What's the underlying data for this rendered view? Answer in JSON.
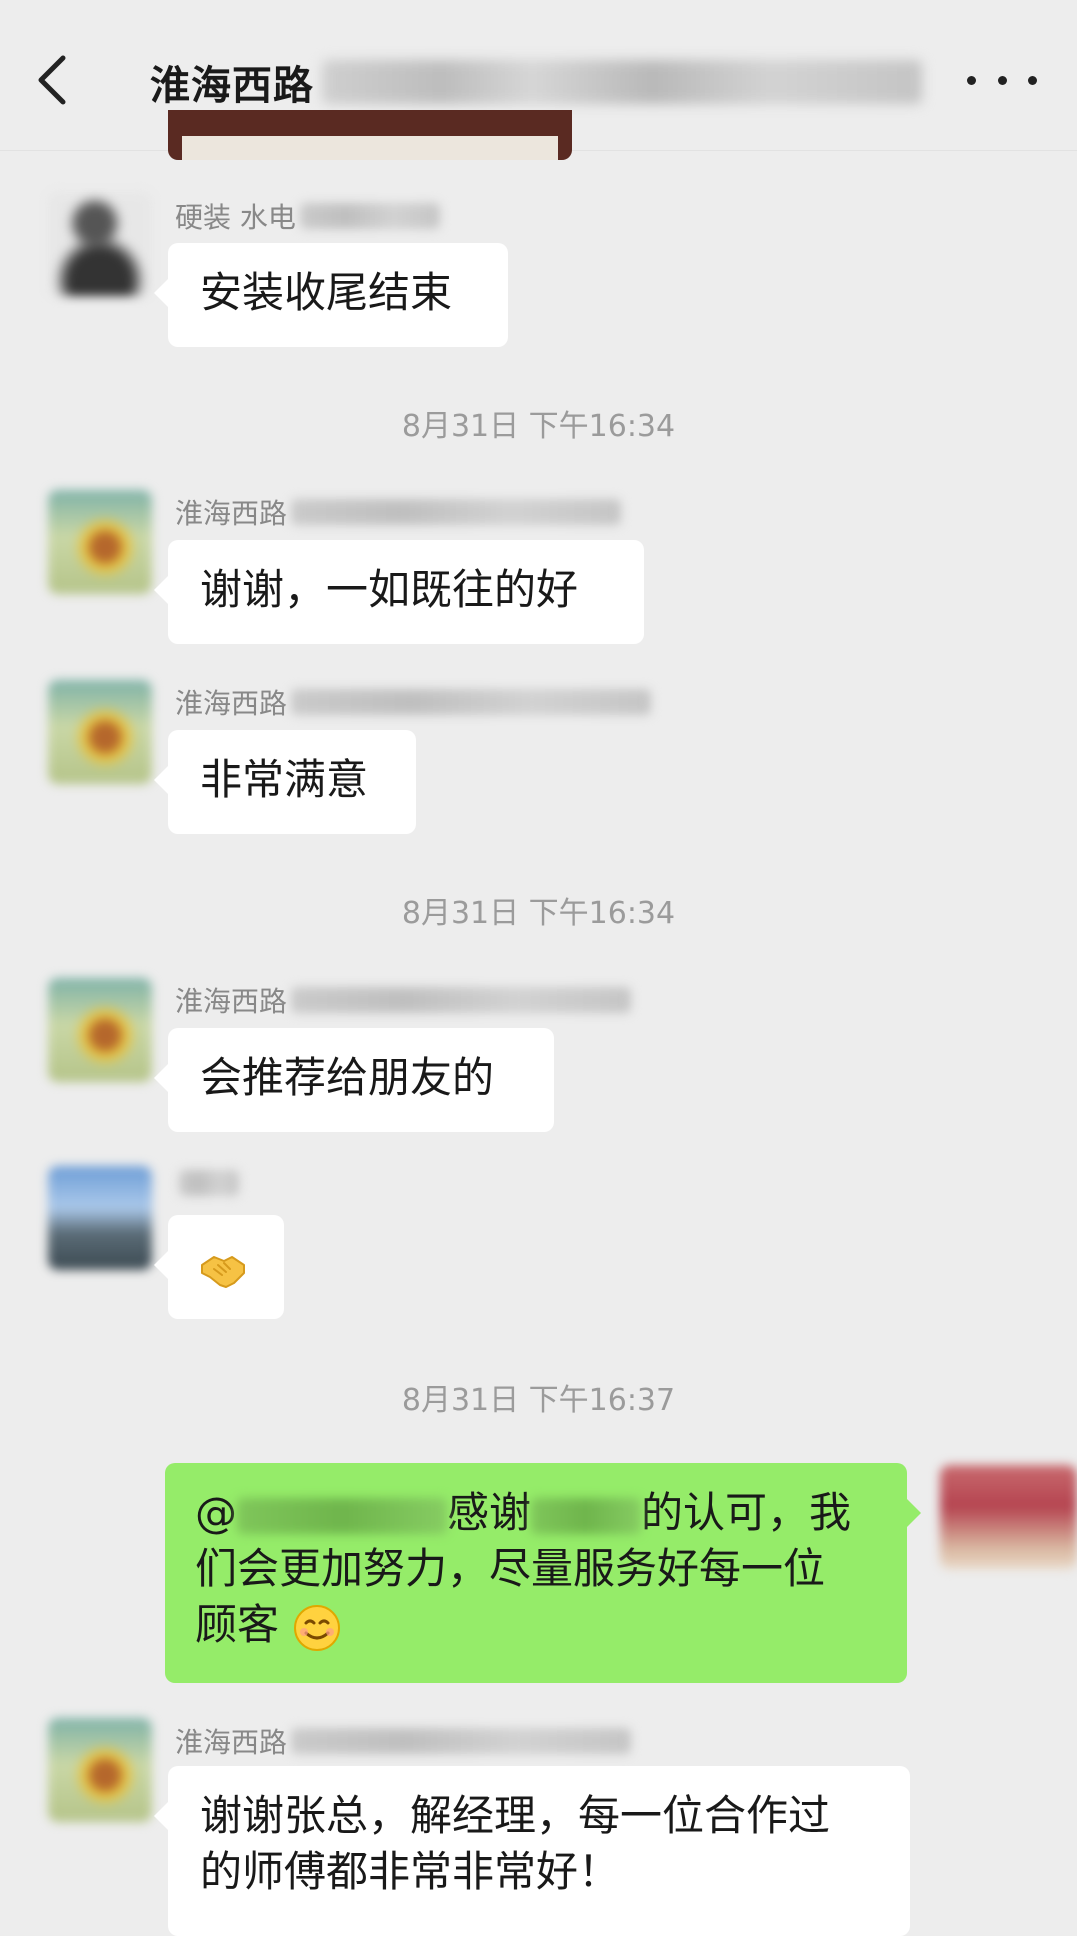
{
  "header": {
    "title": "淮海西路"
  },
  "messages": [
    {
      "sender": "硬装 水电",
      "text": "安装收尾结束"
    },
    {
      "time": "8月31日 下午16:34"
    },
    {
      "sender": "淮海西路",
      "text": "谢谢，一如既往的好"
    },
    {
      "sender": "淮海西路",
      "text": "非常满意"
    },
    {
      "time": "8月31日 下午16:34"
    },
    {
      "sender": "淮海西路",
      "text": "会推荐给朋友的"
    },
    {
      "sender": "",
      "emoji": "handshake"
    },
    {
      "time": "8月31日 下午16:37"
    },
    {
      "self": true,
      "part1": "@",
      "part2": "感谢",
      "part3": "的认可，我",
      "line2": "们会更加努力，尽量服务好每一位",
      "line3": "顾客",
      "emoji": "smiling-face"
    },
    {
      "sender": "淮海西路",
      "line1": "谢谢张总，解经理，每一位合作过",
      "line2": "的师傅都非常非常好！"
    }
  ],
  "colors": {
    "background": "#ededed",
    "bubble_left": "#ffffff",
    "bubble_right": "#95ec69",
    "time_text": "#9b9b9b",
    "sender_text": "#888888"
  },
  "icons": [
    "back-arrow-icon",
    "more-dots-icon",
    "handshake-emoji-icon",
    "smiling-face-emoji-icon"
  ]
}
